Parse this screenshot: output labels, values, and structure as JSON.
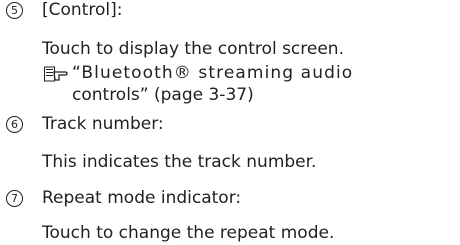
{
  "entries": [
    {
      "number": "5",
      "term": "[Control]:",
      "description": "Touch to display the control screen.",
      "reference": {
        "icon": "reference-pointing-hand-icon",
        "line1": "“Bluetooth® streaming audio",
        "line2": "controls” (page 3-37)"
      }
    },
    {
      "number": "6",
      "term": "Track number:",
      "description": "This indicates the track number."
    },
    {
      "number": "7",
      "term": "Repeat mode indicator:",
      "description": "Touch to change the repeat mode."
    }
  ]
}
